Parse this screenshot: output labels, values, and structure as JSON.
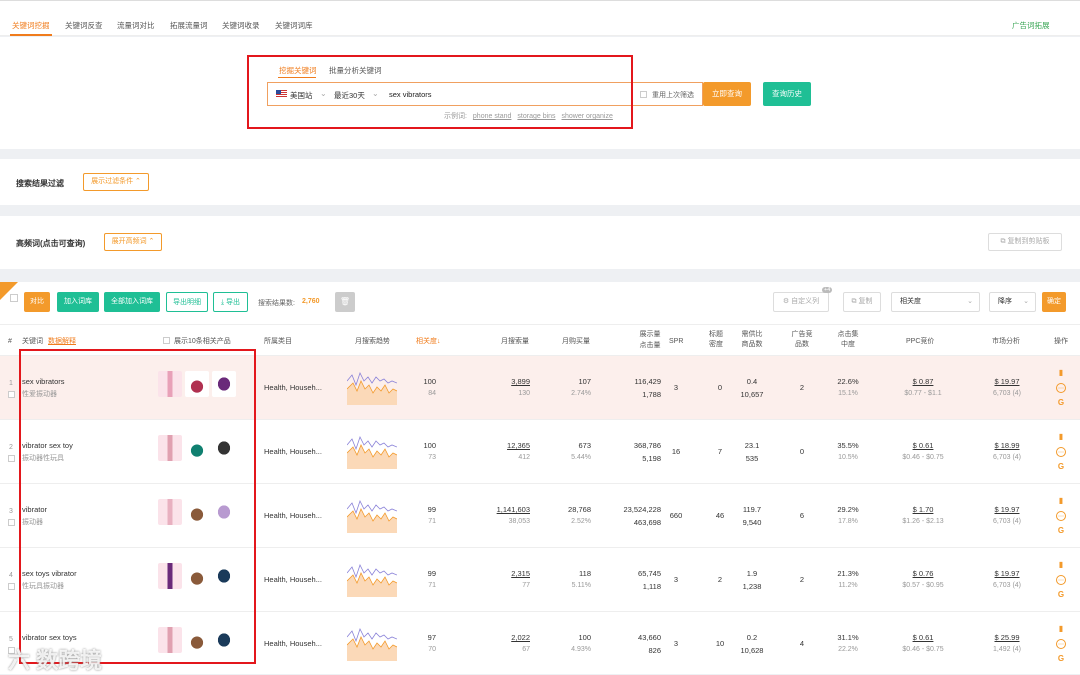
{
  "nav": {
    "tabs": [
      "关键词挖掘",
      "关键词反查",
      "流量词对比",
      "拓展流量词",
      "关键词收录",
      "关键词词库"
    ],
    "right_link": "广告词拓展"
  },
  "search": {
    "tabs": [
      "挖掘关键词",
      "批量分析关键词"
    ],
    "site": "美国站",
    "period": "最近30天",
    "keyword": "sex vibrators",
    "reuse_label": "重用上次筛选",
    "query_btn": "立即查询",
    "history_btn": "查询历史",
    "example_prefix": "示例词:",
    "examples": [
      "phone stand",
      "storage bins",
      "shower organize"
    ]
  },
  "filter": {
    "title": "搜索结果过滤",
    "button": "展示过滤条件"
  },
  "highfreq": {
    "title": "高频词(点击可查询)",
    "button": "展开高频词",
    "copy": "复制到剪贴板"
  },
  "toolbar": {
    "compare": "对比",
    "add": "加入词库",
    "add_all": "全部加入词库",
    "export_detail": "导出明细",
    "export": "导出",
    "count_label": "搜索结果数:",
    "count": "2,760",
    "custom_cols": "自定义列",
    "custom_badge": "+4",
    "copy": "复制",
    "sort_field": "相关度",
    "sort_order": "降序",
    "confirm": "确定"
  },
  "columns": {
    "idx": "#",
    "keyword": "关键词",
    "ref_link": "数据解释",
    "show10": "展示10条相关产品",
    "category": "所属类目",
    "trend": "月搜索趋势",
    "relevance": "相关度",
    "monthly_search": "月搜索量",
    "monthly_purchase": "月购买量",
    "impressions": "展示量",
    "clicks": "点击量",
    "spr": "SPR",
    "title_density": "标题密度",
    "supply_demand": "需供比",
    "products": "商品数",
    "ad_products": "广告竞品数",
    "click_conc": "点击集中度",
    "ppc": "PPC竞价",
    "market": "市场分析",
    "ops": "操作"
  },
  "rows": [
    {
      "idx": "1",
      "kw": "sex vibrators",
      "cn": "性爱振动器",
      "category": "Health, Househ...",
      "rel": "100",
      "rel_sub": "84",
      "ms": "3,899",
      "ms_sub": "130",
      "mp": "107",
      "mp_sub": "2.74%",
      "imp": "116,429",
      "clk": "1,788",
      "spr": "3",
      "td": "0",
      "sd": "0.4",
      "prod": "10,657",
      "ad": "2",
      "cc": "22.6%",
      "cc_sub": "15.1%",
      "ppc": "$ 0.87",
      "ppc_range": "$0.77 - $1.1",
      "mk": "$ 19.97",
      "mk_sub": "6,703 (4)"
    },
    {
      "idx": "2",
      "kw": "vibrator sex toy",
      "cn": "振动器性玩具",
      "category": "Health, Househ...",
      "rel": "100",
      "rel_sub": "73",
      "ms": "12,365",
      "ms_sub": "412",
      "mp": "673",
      "mp_sub": "5.44%",
      "imp": "368,786",
      "clk": "5,198",
      "spr": "16",
      "td": "7",
      "sd": "23.1",
      "prod": "535",
      "ad": "0",
      "cc": "35.5%",
      "cc_sub": "10.5%",
      "ppc": "$ 0.61",
      "ppc_range": "$0.46 - $0.75",
      "mk": "$ 18.99",
      "mk_sub": "6,703 (4)"
    },
    {
      "idx": "3",
      "kw": "vibrator",
      "cn": "振动器",
      "category": "Health, Househ...",
      "rel": "99",
      "rel_sub": "71",
      "ms": "1,141,603",
      "ms_sub": "38,053",
      "mp": "28,768",
      "mp_sub": "2.52%",
      "imp": "23,524,228",
      "clk": "463,698",
      "spr": "660",
      "td": "46",
      "sd": "119.7",
      "prod": "9,540",
      "ad": "6",
      "cc": "29.2%",
      "cc_sub": "17.8%",
      "ppc": "$ 1.70",
      "ppc_range": "$1.26 - $2.13",
      "mk": "$ 19.97",
      "mk_sub": "6,703 (4)"
    },
    {
      "idx": "4",
      "kw": "sex toys vibrator",
      "cn": "性玩具振动器",
      "category": "Health, Househ...",
      "rel": "99",
      "rel_sub": "71",
      "ms": "2,315",
      "ms_sub": "77",
      "mp": "118",
      "mp_sub": "5.11%",
      "imp": "65,745",
      "clk": "1,118",
      "spr": "3",
      "td": "2",
      "sd": "1.9",
      "prod": "1,238",
      "ad": "2",
      "cc": "21.3%",
      "cc_sub": "11.2%",
      "ppc": "$ 0.76",
      "ppc_range": "$0.57 - $0.95",
      "mk": "$ 19.97",
      "mk_sub": "6,703 (4)"
    },
    {
      "idx": "5",
      "kw": "vibrator sex toys",
      "cn": "",
      "category": "Health, Househ...",
      "rel": "97",
      "rel_sub": "70",
      "ms": "2,022",
      "ms_sub": "67",
      "mp": "100",
      "mp_sub": "4.93%",
      "imp": "43,660",
      "clk": "826",
      "spr": "3",
      "td": "10",
      "sd": "0.2",
      "prod": "10,628",
      "ad": "4",
      "cc": "31.1%",
      "cc_sub": "22.2%",
      "ppc": "$ 0.61",
      "ppc_range": "$0.46 - $0.75",
      "mk": "$ 25.99",
      "mk_sub": "1,492 (4)"
    }
  ],
  "watermark": "六 数跨境",
  "colors": {
    "accent": "#f39a2b",
    "teal": "#1fbf95",
    "highlight": "#e3171c"
  }
}
